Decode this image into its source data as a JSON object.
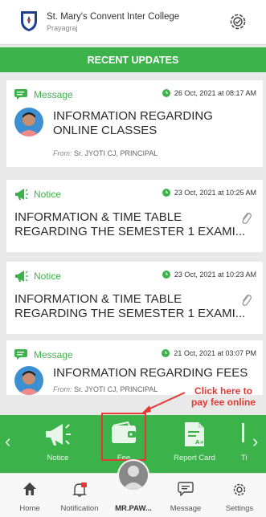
{
  "header": {
    "school_name": "St. Mary's Convent Inter College",
    "city": "Prayagraj"
  },
  "banner": {
    "title": "RECENT UPDATES"
  },
  "feed": [
    {
      "type": "Message",
      "date": "26 Oct, 2021 at 08:17 AM",
      "title_line1": "INFORMATION REGARDING",
      "title_line2": "ONLINE CLASSES",
      "from_label": "From:",
      "from": "Sr. JYOTI CJ, PRINCIPAL"
    },
    {
      "type": "Notice",
      "date": "23 Oct, 2021 at 10:25 AM",
      "title_line1": "INFORMATION & TIME TABLE",
      "title_line2": "REGARDING THE SEMESTER 1 EXAMI..."
    },
    {
      "type": "Notice",
      "date": "23 Oct, 2021 at 10:23 AM",
      "title_line1": "INFORMATION & TIME TABLE",
      "title_line2": "REGARDING THE SEMESTER 1 EXAMI..."
    },
    {
      "type": "Message",
      "date": "21 Oct, 2021 at 03:07 PM",
      "title_line1": "INFORMATION REGARDING FEES",
      "from_label": "From:",
      "from": "Sr. JYOTI CJ, PRINCIPAL"
    }
  ],
  "annotation": {
    "line1": "Click here to",
    "line2": "pay fee online"
  },
  "quick_menu": {
    "items": [
      {
        "label": "Notice",
        "icon": "megaphone-icon"
      },
      {
        "label": "Fee",
        "icon": "wallet-icon"
      },
      {
        "label": "Report Card",
        "icon": "report-card-icon"
      },
      {
        "label": "Ti",
        "icon": "timetable-icon"
      }
    ]
  },
  "bottom_nav": {
    "items": [
      {
        "label": "Home",
        "icon": "home-icon"
      },
      {
        "label": "Notification",
        "icon": "bell-icon"
      },
      {
        "label": "MR.PAW...",
        "icon": "profile-icon"
      },
      {
        "label": "Message",
        "icon": "chat-icon"
      },
      {
        "label": "Settings",
        "icon": "gear-icon"
      }
    ]
  },
  "colors": {
    "accent_green": "#3cb34a",
    "annotation_red": "#e53935"
  }
}
